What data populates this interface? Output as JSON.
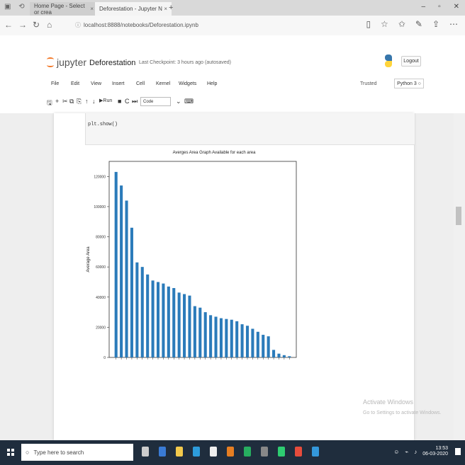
{
  "browser": {
    "tabs": [
      {
        "label": "Home Page - Select or crea"
      },
      {
        "label": "Deforestation - Jupyter N"
      }
    ],
    "new_tab": "+",
    "url": "localhost:8888/notebooks/Deforestation.ipynb"
  },
  "jupyter": {
    "logo_text": "jupyter",
    "notebook_name": "Deforestation",
    "checkpoint": "Last Checkpoint: 3 hours ago  (autosaved)",
    "logout": "Logout",
    "menu": [
      "File",
      "Edit",
      "View",
      "Insert",
      "Cell",
      "Kernel",
      "Widgets",
      "Help"
    ],
    "trusted": "Trusted",
    "kernel": "Python 3 ○",
    "toolbar": {
      "run_label": "Run",
      "cell_type": "Code"
    }
  },
  "cell": {
    "code": "plt.show()"
  },
  "chart_data": {
    "type": "bar",
    "title": "Averges Area Graph Available for each area",
    "ylabel": "Average Area",
    "xlabel": "",
    "ylim": [
      0,
      130000
    ],
    "yticks": [
      0,
      20000,
      40000,
      60000,
      80000,
      100000,
      120000
    ],
    "values": [
      123000,
      114000,
      104000,
      86000,
      63000,
      60000,
      55000,
      51000,
      50000,
      49000,
      47000,
      46000,
      43000,
      42000,
      41000,
      34000,
      33000,
      30000,
      28000,
      27000,
      26000,
      25500,
      25000,
      24000,
      22000,
      21000,
      19000,
      17000,
      15000,
      14000,
      5000,
      2500,
      1500,
      800
    ]
  },
  "windows": {
    "watermark_title": "Activate Windows",
    "watermark_text": "Go to Settings to activate Windows.",
    "search_placeholder": "Type here to search",
    "clock_time": "13:53",
    "clock_date": "06-03-2020"
  }
}
